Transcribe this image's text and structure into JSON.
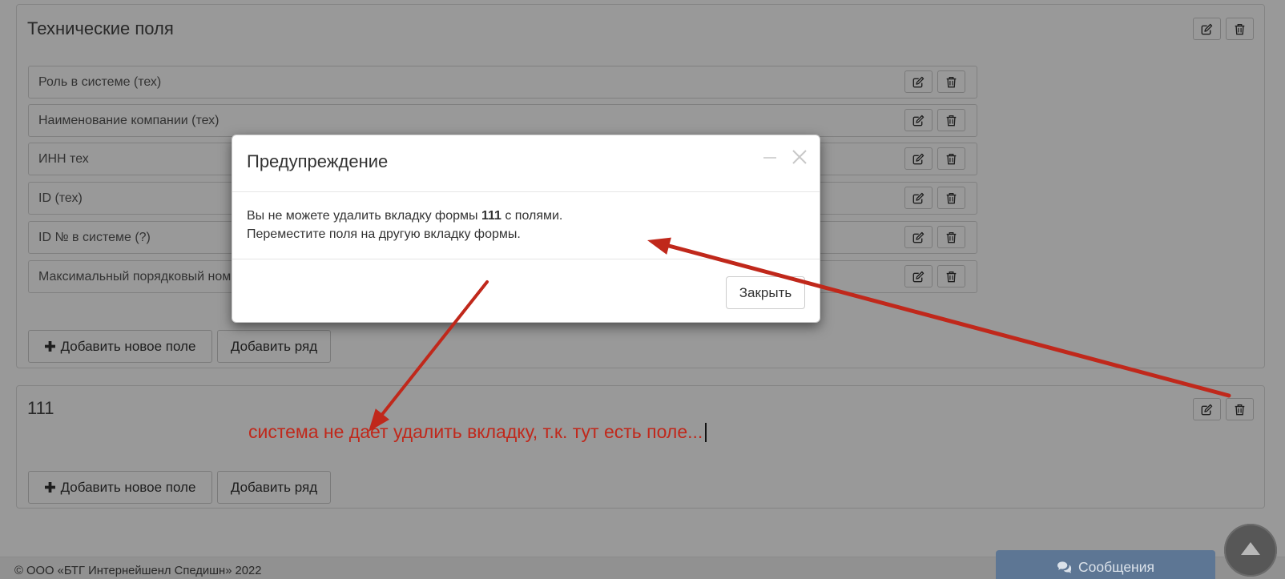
{
  "sections": [
    {
      "title": "Технические поля",
      "fields": [
        {
          "label": "Роль в системе (тех)"
        },
        {
          "label": "Наименование компании (тех)"
        },
        {
          "label": "ИНН тех"
        },
        {
          "label": "ID (тех)"
        },
        {
          "label": "ID № в системе (?)"
        },
        {
          "label": "Максимальный порядковый ном"
        }
      ],
      "add_field_label": "Добавить новое поле",
      "add_row_label": "Добавить ряд"
    },
    {
      "title": "111",
      "fields": [],
      "add_field_label": "Добавить новое поле",
      "add_row_label": "Добавить ряд"
    }
  ],
  "icons": {
    "edit": "edit-icon",
    "delete": "trash-icon",
    "add": "plus-icon",
    "messages": "comments-icon",
    "scroll_top": "triangle-up-icon",
    "modal_minimize": "minimize-icon",
    "modal_close": "close-icon"
  },
  "modal": {
    "title": "Предупреждение",
    "line1_prefix": "Вы не можете удалить вкладку формы ",
    "tab_name": "111",
    "line1_suffix": " с полями.",
    "line2": "Переместите поля на другую вкладку формы.",
    "close_label": "Закрыть"
  },
  "annotation": {
    "text": "система не дает удалить вкладку, т.к. тут есть поле..."
  },
  "messages_widget": {
    "label": "Сообщения"
  },
  "footer": {
    "copyright": "© ООО «БТГ Интернейшенл Спедишн» 2022"
  },
  "colors": {
    "annotation": "#c0281b",
    "messages_widget": "#5d7694",
    "backdrop": "rgba(0,0,0,0.4)"
  }
}
